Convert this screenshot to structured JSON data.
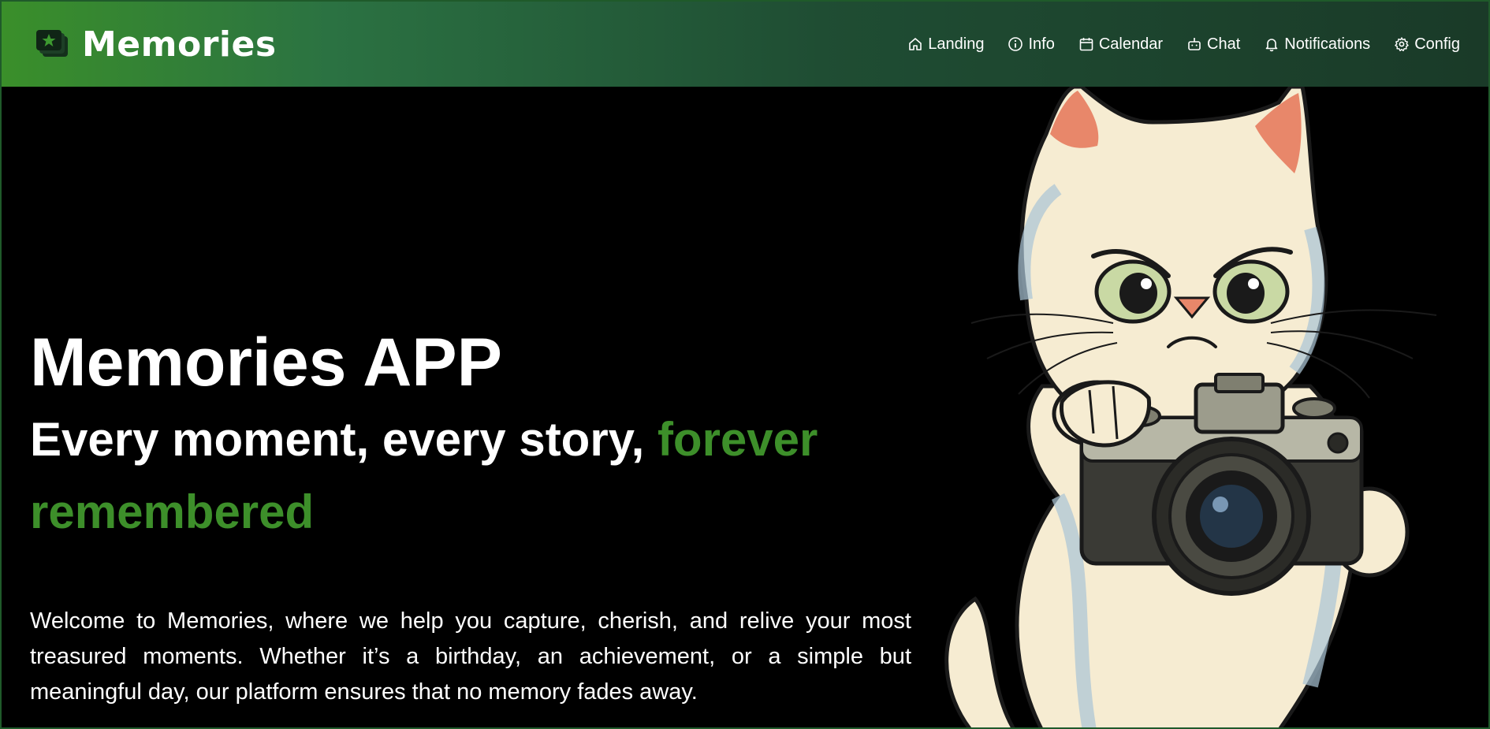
{
  "app": {
    "brand": "Memories",
    "brand_icon": "photo-stack-star-icon",
    "accent_color": "#3d8f2a"
  },
  "nav": {
    "items": [
      {
        "label": "Landing",
        "icon": "home-icon"
      },
      {
        "label": "Info",
        "icon": "info-icon"
      },
      {
        "label": "Calendar",
        "icon": "calendar-icon"
      },
      {
        "label": "Chat",
        "icon": "bot-icon"
      },
      {
        "label": "Notifications",
        "icon": "bell-icon"
      },
      {
        "label": "Config",
        "icon": "gear-icon"
      }
    ]
  },
  "hero": {
    "title": "Memories APP",
    "subtitle_plain": "Every moment, every story, ",
    "subtitle_accent": "forever remembered",
    "body": "Welcome to Memories, where we help you capture, cherish, and relive your most treasured moments. Whether it’s a birthday, an achievement, or a simple but meaningful day, our platform ensures that no memory fades away.",
    "illustration": "cat-with-camera-illustration"
  }
}
